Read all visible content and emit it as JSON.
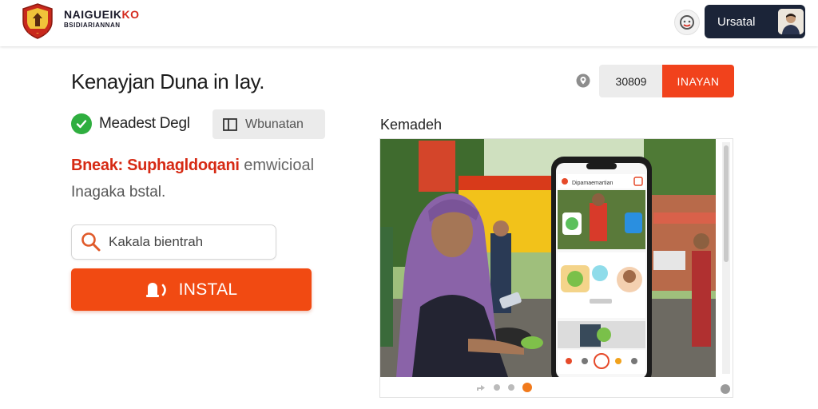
{
  "header": {
    "logo_line1": "NAIGUEIK",
    "logo_line1_accent": "KO",
    "logo_line2": "BSIDIARIANNAN",
    "user_name": "Ursatal",
    "help_icon": "help-face-icon"
  },
  "main": {
    "title": "Kenayjan Duna in Iay.",
    "count_value": "30809",
    "top_cta_label": "INAYAN",
    "verified_label": "Meadest Degl",
    "website_label": "Wbunatan",
    "promo_red": "Bneak: Suphagldoqani",
    "promo_gray": "emwicioal",
    "sub_text": "Inagaka bstal.",
    "search_value": "Kakala bientrah",
    "install_label": "INSTAL"
  },
  "preview": {
    "label": "Kemadeh",
    "phone_header": "Dipamaemartian"
  },
  "colors": {
    "accent": "#f14a12",
    "navy": "#1b2438",
    "verified_green": "#2fae3f"
  }
}
